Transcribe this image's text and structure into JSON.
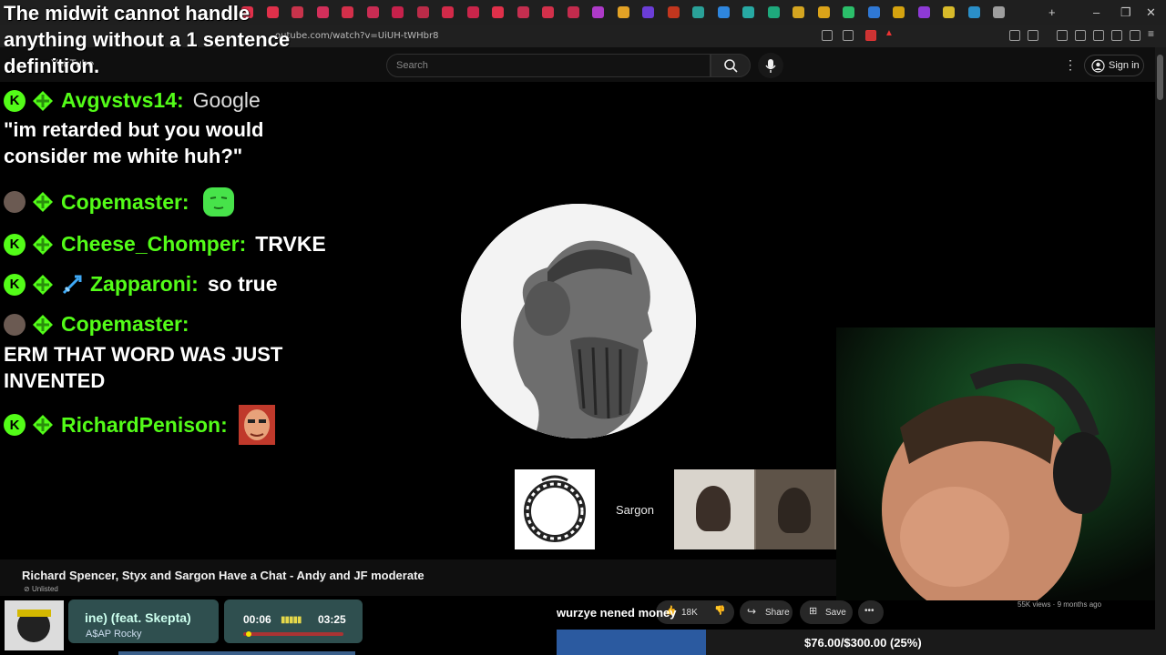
{
  "browser": {
    "url": "outube.com/watch?v=UiUH-tWHbr8",
    "tab_colors": [
      "#e0304a",
      "#e0304a",
      "#c8334b",
      "#d22f5a",
      "#d32f4a",
      "#c92c53",
      "#c6214b",
      "#bb2b48",
      "#d32a49",
      "#c9254a",
      "#e0304a",
      "#c42e4f",
      "#d2304a",
      "#c32b4d",
      "#ae3ac8",
      "#e3a225",
      "#6b3dd6",
      "#c2361e",
      "#2aa198",
      "#2e86de",
      "#27a9a3",
      "#1ea97c",
      "#d4a520",
      "#dba319",
      "#2bbf6a",
      "#2f78d4",
      "#d5a30f",
      "#8e3ad6",
      "#d8ba2a",
      "#2a8fc8",
      "#9e9e9e"
    ]
  },
  "overlay": {
    "text": "The midwit cannot handle anything without a 1 sentence definition."
  },
  "youtube": {
    "logo": "YouTube",
    "search_placeholder": "Search",
    "sign_in": "Sign in",
    "video_title": "Richard Spencer, Styx and Sargon Have a Chat - Andy and JF moderate",
    "unlisted": "Unlisted",
    "likes": "18K",
    "share": "Share",
    "save": "Save",
    "related_meta": "55K views · 9 months ago"
  },
  "chat": [
    {
      "user": "Avgvstvs14:",
      "badge": "k",
      "message": "Google",
      "message_style": "google",
      "body": "\"im retarded but you would consider me white huh?\""
    },
    {
      "user": "Copemaster:",
      "badge": "avatar",
      "message": "",
      "emote": "green-face"
    },
    {
      "user": "Cheese_Chomper:",
      "badge": "k",
      "message": "TRVKE"
    },
    {
      "user": "Zapparoni:",
      "badge": "k",
      "message": "so true",
      "extra_badge": "sword"
    },
    {
      "user": "Copemaster:",
      "badge": "avatar",
      "message": "",
      "body": "ERM THAT WORD WAS JUST INVENTED"
    },
    {
      "user": "RichardPenison:",
      "badge": "k",
      "message": "",
      "emote": "face-photo"
    }
  ],
  "video": {
    "participant_name": "Sargon"
  },
  "music": {
    "title": "ine) (feat. Skepta)",
    "artist": "A$AP Rocky",
    "elapsed": "00:06",
    "total": "03:25",
    "progress_fraction": 0.03
  },
  "ticker": {
    "text": "wurzye nened money"
  },
  "goal": {
    "text": "$76.00/$300.00 (25%)",
    "fraction": 0.25,
    "fill_color": "#2b5aa0"
  }
}
